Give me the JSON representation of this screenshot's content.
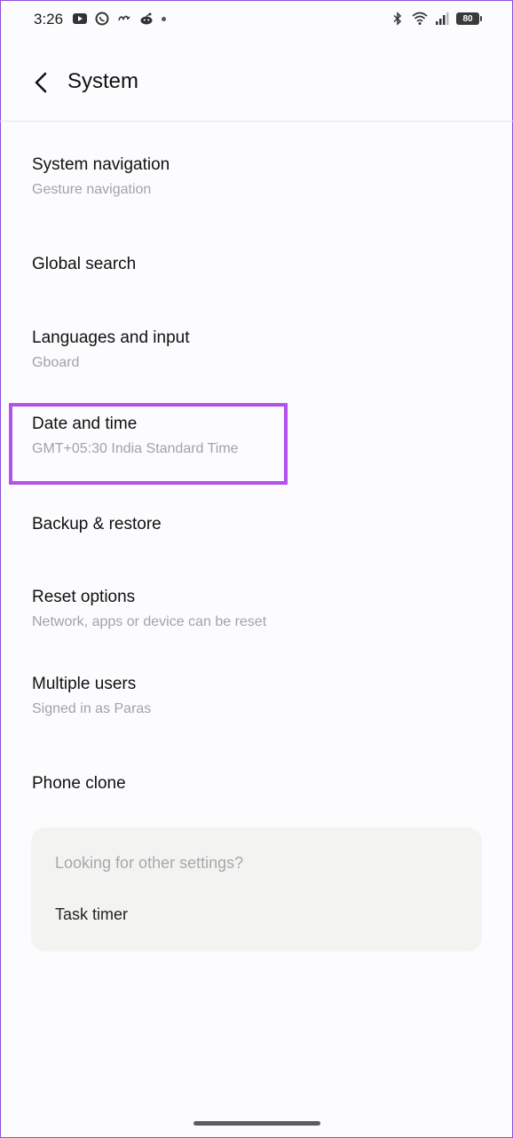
{
  "status_bar": {
    "time": "3:26",
    "battery_level": "80",
    "left_icons": [
      "youtube-icon",
      "whatsapp-icon",
      "notification-icon",
      "reddit-icon",
      "more-dot-icon"
    ],
    "right_icons": [
      "bluetooth-icon",
      "wifi-icon",
      "signal-icon",
      "battery-icon"
    ]
  },
  "header": {
    "title": "System"
  },
  "items": [
    {
      "title": "System navigation",
      "subtitle": "Gesture navigation"
    },
    {
      "title": "Global search",
      "subtitle": ""
    },
    {
      "title": "Languages and input",
      "subtitle": "Gboard"
    },
    {
      "title": "Date and time",
      "subtitle": "GMT+05:30 India Standard Time"
    },
    {
      "title": "Backup & restore",
      "subtitle": ""
    },
    {
      "title": "Reset options",
      "subtitle": "Network, apps or device can be reset"
    },
    {
      "title": "Multiple users",
      "subtitle": "Signed in as Paras"
    },
    {
      "title": "Phone clone",
      "subtitle": ""
    }
  ],
  "suggestions": {
    "title": "Looking for other settings?",
    "link": "Task timer"
  },
  "colors": {
    "highlight": "#b152ef",
    "background": "#fcfbfd",
    "subtitle": "#a4a2a8"
  }
}
